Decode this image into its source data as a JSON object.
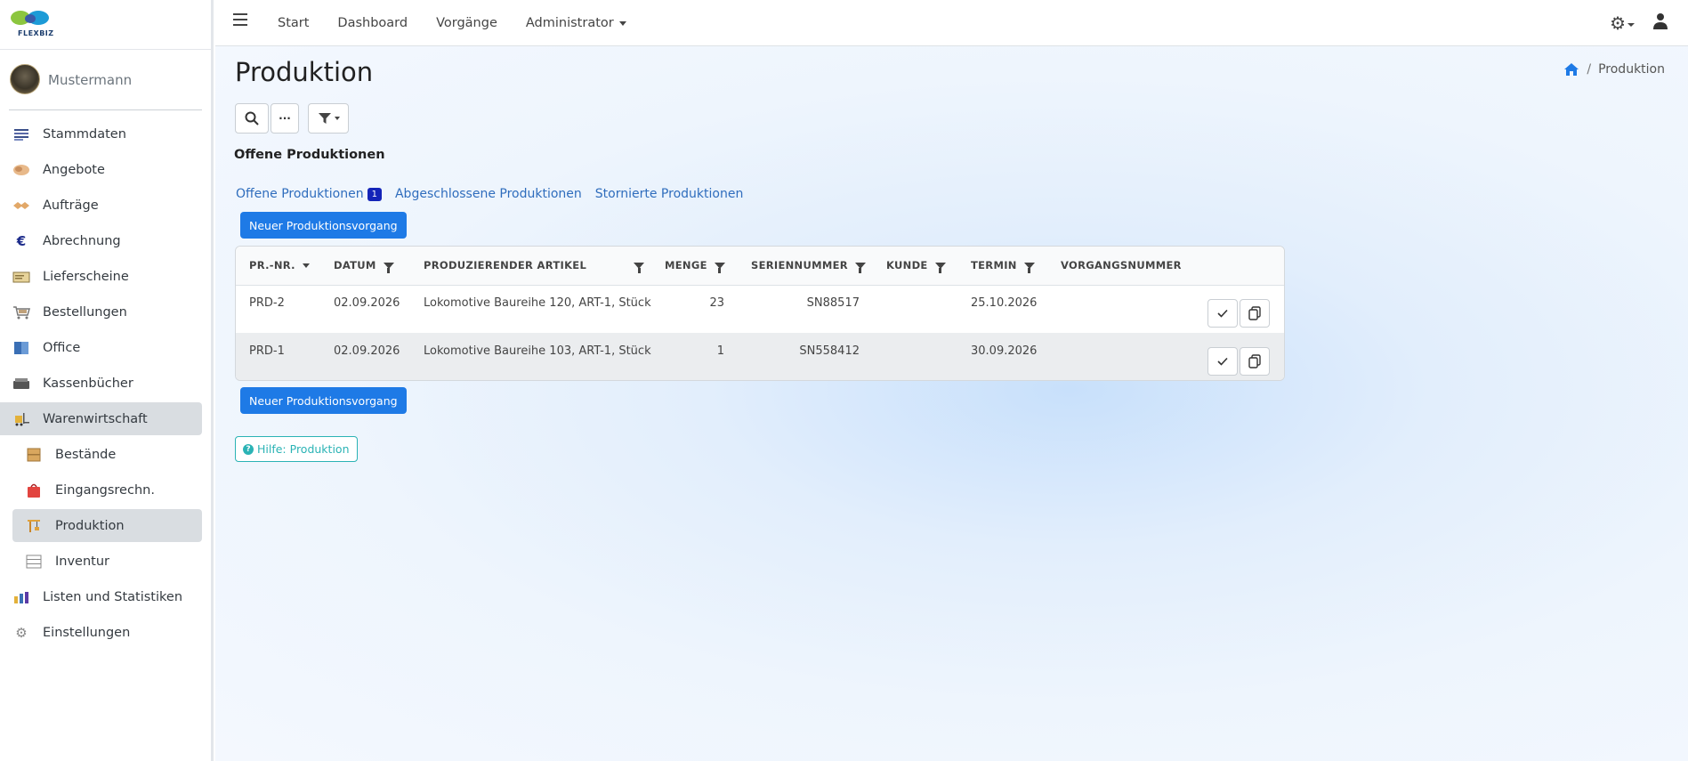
{
  "brand": {
    "logo_text": "FLEXBIZ"
  },
  "user": {
    "name": "Mustermann"
  },
  "sidebar": {
    "items": [
      {
        "label": "Stammdaten",
        "icon": "database-icon"
      },
      {
        "label": "Angebote",
        "icon": "handshake-icon"
      },
      {
        "label": "Aufträge",
        "icon": "agreement-icon"
      },
      {
        "label": "Abrechnung",
        "icon": "euro-icon"
      },
      {
        "label": "Lieferscheine",
        "icon": "delivery-note-icon"
      },
      {
        "label": "Bestellungen",
        "icon": "cart-icon"
      },
      {
        "label": "Office",
        "icon": "book-icon"
      },
      {
        "label": "Kassenbücher",
        "icon": "cashbox-icon"
      },
      {
        "label": "Warenwirtschaft",
        "icon": "forklift-icon"
      },
      {
        "label": "Bestände",
        "icon": "boxes-icon"
      },
      {
        "label": "Eingangsrechn.",
        "icon": "shopping-bag-icon"
      },
      {
        "label": "Produktion",
        "icon": "crane-icon"
      },
      {
        "label": "Inventur",
        "icon": "shelf-icon"
      },
      {
        "label": "Listen und Statistiken",
        "icon": "bar-chart-icon"
      },
      {
        "label": "Einstellungen",
        "icon": "gear-icon"
      }
    ]
  },
  "topnav": {
    "start": "Start",
    "dashboard": "Dashboard",
    "vorgaenge": "Vorgänge",
    "admin": "Administrator"
  },
  "page": {
    "title": "Produktion",
    "breadcrumb_current": "Produktion",
    "section_title": "Offene Produktionen",
    "more_label": "···",
    "tabs": {
      "open": "Offene Produktionen",
      "open_count": "1",
      "closed": "Abgeschlossene Produktionen",
      "cancelled": "Stornierte Produktionen"
    },
    "new_button": "Neuer Produktionsvorgang",
    "help": "Hilfe: Produktion"
  },
  "table": {
    "headers": {
      "nr": "PR.-NR.",
      "datum": "DATUM",
      "artikel": "PRODUZIERENDER ARTIKEL",
      "menge": "MENGE",
      "serien": "SERIENNUMMER",
      "kunde": "KUNDE",
      "termin": "TERMIN",
      "vorgang": "VORGANGSNUMMER"
    },
    "rows": [
      {
        "nr": "PRD-2",
        "datum": "02.09.2026",
        "artikel": "Lokomotive Baureihe 120, ART-1, Stück",
        "menge": "23",
        "serien": "SN88517",
        "kunde": "",
        "termin": "25.10.2026",
        "vorgang": ""
      },
      {
        "nr": "PRD-1",
        "datum": "02.09.2026",
        "artikel": "Lokomotive Baureihe 103, ART-1, Stück",
        "menge": "1",
        "serien": "SN558412",
        "kunde": "",
        "termin": "30.09.2026",
        "vorgang": ""
      }
    ]
  },
  "colors": {
    "primary": "#1e7ae6",
    "link": "#2f6dbd",
    "badge": "#1424b8",
    "help": "#2bb3b5"
  }
}
